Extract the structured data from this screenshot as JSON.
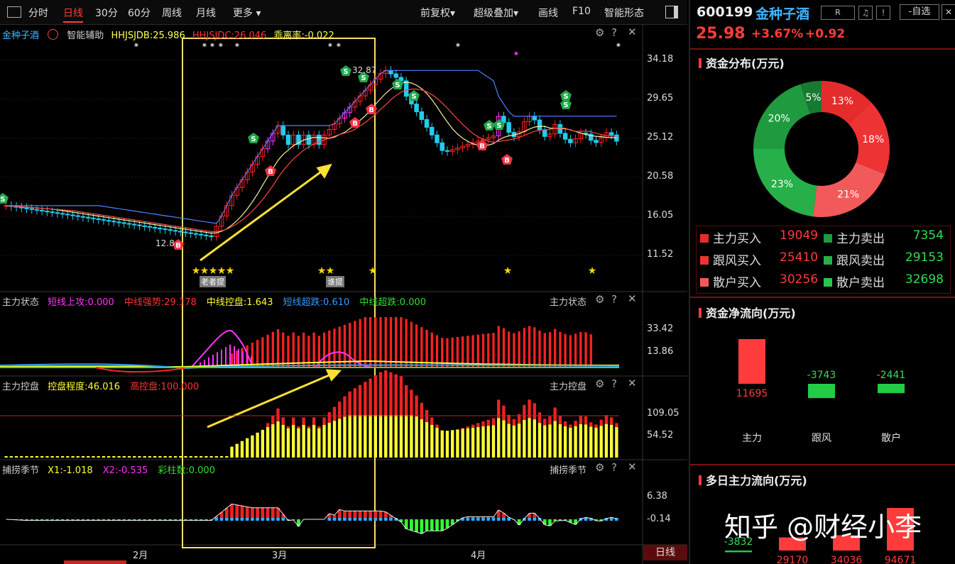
{
  "toolbar": {
    "tabs": [
      "分时",
      "日线",
      "30分",
      "60分",
      "周线",
      "月线",
      "更多"
    ],
    "right_items": [
      "前复权",
      "超级叠加",
      "画线",
      "F10",
      "智能形态"
    ]
  },
  "main_panel": {
    "stock_name": "金种子酒",
    "assist_label": "智能辅助",
    "hhjsjdb": "HHJSJDB:25.986",
    "hhjsjdc": "HHJSJDC:26.046",
    "deviation": "乖离率:-0.022",
    "y_ticks": [
      "34.18",
      "29.65",
      "25.12",
      "20.58",
      "16.05",
      "11.52"
    ],
    "peak_label": "32.87",
    "low_label": "12.8",
    "tag_labels": [
      "老者提",
      "谁提"
    ]
  },
  "panel2": {
    "name": "主力状态",
    "items": [
      "短线上攻:0.000",
      "中线强势:29.178",
      "中线控盘:1.643",
      "短线超跌:0.610",
      "中线超跌:0.000"
    ],
    "colors": [
      "#ff33ff",
      "#ff3333",
      "#ffff33",
      "#3399ff",
      "#33dd33"
    ],
    "right_name": "主力状态",
    "y_ticks": [
      "33.42",
      "13.86"
    ]
  },
  "panel3": {
    "name": "主力控盘",
    "items": [
      "控盘程度:46.016",
      "高控盘:100.000"
    ],
    "colors": [
      "#ffff33",
      "#ff3333"
    ],
    "right_name": "主力控盘",
    "y_ticks": [
      "109.05",
      "54.52"
    ]
  },
  "panel4": {
    "name": "捕捞季节",
    "items": [
      "X1:-1.018",
      "X2:-0.535",
      "彩柱数:0.000"
    ],
    "colors": [
      "#ffff33",
      "#ff33ff",
      "#33dd33"
    ],
    "right_name": "捕捞季节",
    "y_ticks": [
      "6.38",
      "-0.14"
    ]
  },
  "x_axis": {
    "labels": [
      "2月",
      "3月",
      "4月"
    ],
    "period_badge": "日线"
  },
  "right_panel": {
    "code": "600199",
    "name": "金种子酒",
    "badge_r": "R",
    "btn_self": "-自选",
    "price": "25.98",
    "change_pct": "+3.67%",
    "change_amt": "+0.92",
    "fund_dist_title": "资金分布(万元)",
    "donut": {
      "slices": [
        {
          "label": "13%",
          "value": 13,
          "color": "#e52c2c"
        },
        {
          "label": "18%",
          "value": 18,
          "color": "#ee3333"
        },
        {
          "label": "21%",
          "value": 21,
          "color": "#f25a5a"
        },
        {
          "label": "23%",
          "value": 23,
          "color": "#27b04a"
        },
        {
          "label": "20%",
          "value": 20,
          "color": "#1f9a3e"
        },
        {
          "label": "5%",
          "value": 5,
          "color": "#167a30"
        }
      ]
    },
    "flow_table": [
      {
        "buy_label": "主力买入",
        "buy_value": "19049",
        "sell_label": "主力卖出",
        "sell_value": "7354"
      },
      {
        "buy_label": "跟风买入",
        "buy_value": "25410",
        "sell_label": "跟风卖出",
        "sell_value": "29153"
      },
      {
        "buy_label": "散户买入",
        "buy_value": "30256",
        "sell_label": "散户卖出",
        "sell_value": "32698"
      }
    ],
    "net_flow_title": "资金净流向(万元)",
    "net_flow": {
      "categories": [
        "主力",
        "跟风",
        "散户"
      ],
      "values": [
        11695,
        -3743,
        -2441
      ],
      "labels": [
        "11695",
        "-3743",
        "-2441"
      ]
    },
    "multi_day_title": "多日主力流向(万元)",
    "multi_day": {
      "values": [
        -3832,
        29170,
        34036,
        94671
      ],
      "labels": [
        "-3832",
        "29170",
        "34036",
        "94671"
      ]
    },
    "watermark": "知乎 @财经小李"
  },
  "colors": {
    "up": "#ff2222",
    "down": "#22ccee",
    "accent": "#ff3b3b",
    "green": "#22cc44"
  }
}
